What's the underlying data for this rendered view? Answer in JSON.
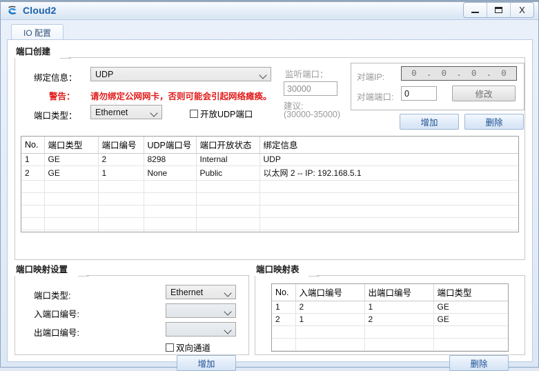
{
  "window": {
    "title": "Cloud2",
    "icon": "cloud-icon",
    "controls": {
      "minimize": "minimize-icon",
      "maximize": "maximize-icon",
      "close": "X"
    }
  },
  "tabs": [
    {
      "label": "IO 配置",
      "active": true
    }
  ],
  "port_create": {
    "title": "端口创建",
    "bind_info_label": "绑定信息：",
    "bind_info_value": "UDP",
    "warning_label": "警告：",
    "warning_text": "请勿绑定公网网卡，否则可能会引起网络瘫痪。",
    "port_type_label": "端口类型：",
    "port_type_value": "Ethernet",
    "open_udp_checkbox": "开放UDP端口",
    "listen_port_label": "监听端口：",
    "listen_port_value": "30000",
    "suggest_label": "建议:",
    "suggest_range": "(30000-35000)",
    "peer_ip_label": "对端IP:",
    "peer_ip_octets": [
      "0",
      "0",
      "0",
      "0"
    ],
    "peer_ip_sep": ".",
    "peer_port_label": "对端端口:",
    "peer_port_value": "0",
    "modify_button": "修改",
    "add_button": "增加",
    "delete_button": "删除",
    "table": {
      "headers": [
        "No.",
        "端口类型",
        "端口编号",
        "UDP端口号",
        "端口开放状态",
        "绑定信息"
      ],
      "rows": [
        [
          "1",
          "GE",
          "2",
          "8298",
          "Internal",
          "UDP"
        ],
        [
          "2",
          "GE",
          "1",
          "None",
          "Public",
          "以太网 2 -- IP: 192.168.5.1"
        ]
      ],
      "empty_rows": 5
    }
  },
  "port_map_settings": {
    "title": "端口映射设置",
    "port_type_label": "端口类型:",
    "port_type_value": "Ethernet",
    "in_port_label": "入端口编号:",
    "in_port_value": "",
    "out_port_label": "出端口编号:",
    "out_port_value": "",
    "bidirectional_checkbox": "双向通道",
    "add_button": "增加"
  },
  "port_map_table": {
    "title": "端口映射表",
    "headers": [
      "No.",
      "入端口编号",
      "出端口编号",
      "端口类型"
    ],
    "rows": [
      [
        "1",
        "2",
        "1",
        "GE"
      ],
      [
        "2",
        "1",
        "2",
        "GE"
      ]
    ],
    "empty_rows": 3,
    "delete_button": "删除"
  },
  "colors": {
    "accent": "#1b5fa8",
    "warning": "#e21b1b",
    "frame": "#b9cbe2",
    "window_bg": "#dfe8f4"
  }
}
